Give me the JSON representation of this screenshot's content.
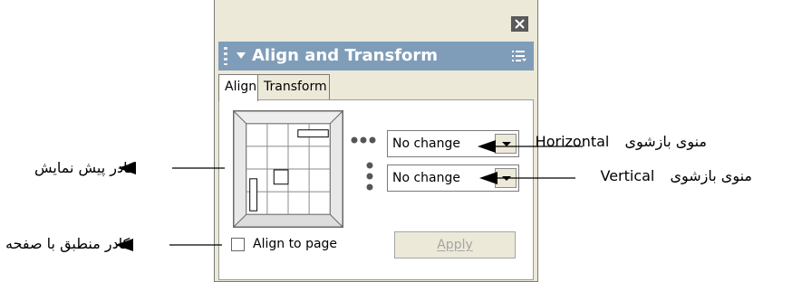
{
  "panel": {
    "title": "Align and Transform",
    "tabs": [
      {
        "label": "Align",
        "active": true
      },
      {
        "label": "Transform",
        "active": false
      }
    ],
    "horizontal_dropdown": {
      "value": "No change"
    },
    "vertical_dropdown": {
      "value": "No change"
    },
    "align_to_page": {
      "label": "Align to page",
      "checked": false
    },
    "apply_button": {
      "label": "Apply",
      "enabled": false
    }
  },
  "annotations": {
    "horizontal_menu": {
      "text": "منوی بازشوی",
      "label": "Horizontal"
    },
    "vertical_menu": {
      "text": "منوی بازشوی",
      "label": "Vertical"
    },
    "preview_frame": {
      "text": "کادر پیش نمایش"
    },
    "align_to_page": {
      "text": "کادر منطبق با صفحه"
    }
  },
  "colors": {
    "panel_bg": "#ece9d8",
    "titlebar_bg": "#7f9db9",
    "apply_disabled_text": "#a5a5a5"
  },
  "icons": {
    "close": "close-icon",
    "collapse": "triangle-down-icon",
    "options_menu": "menu-lines-icon",
    "horizontal_align": "three-dots-horizontal-icon",
    "vertical_align": "three-dots-vertical-icon"
  }
}
